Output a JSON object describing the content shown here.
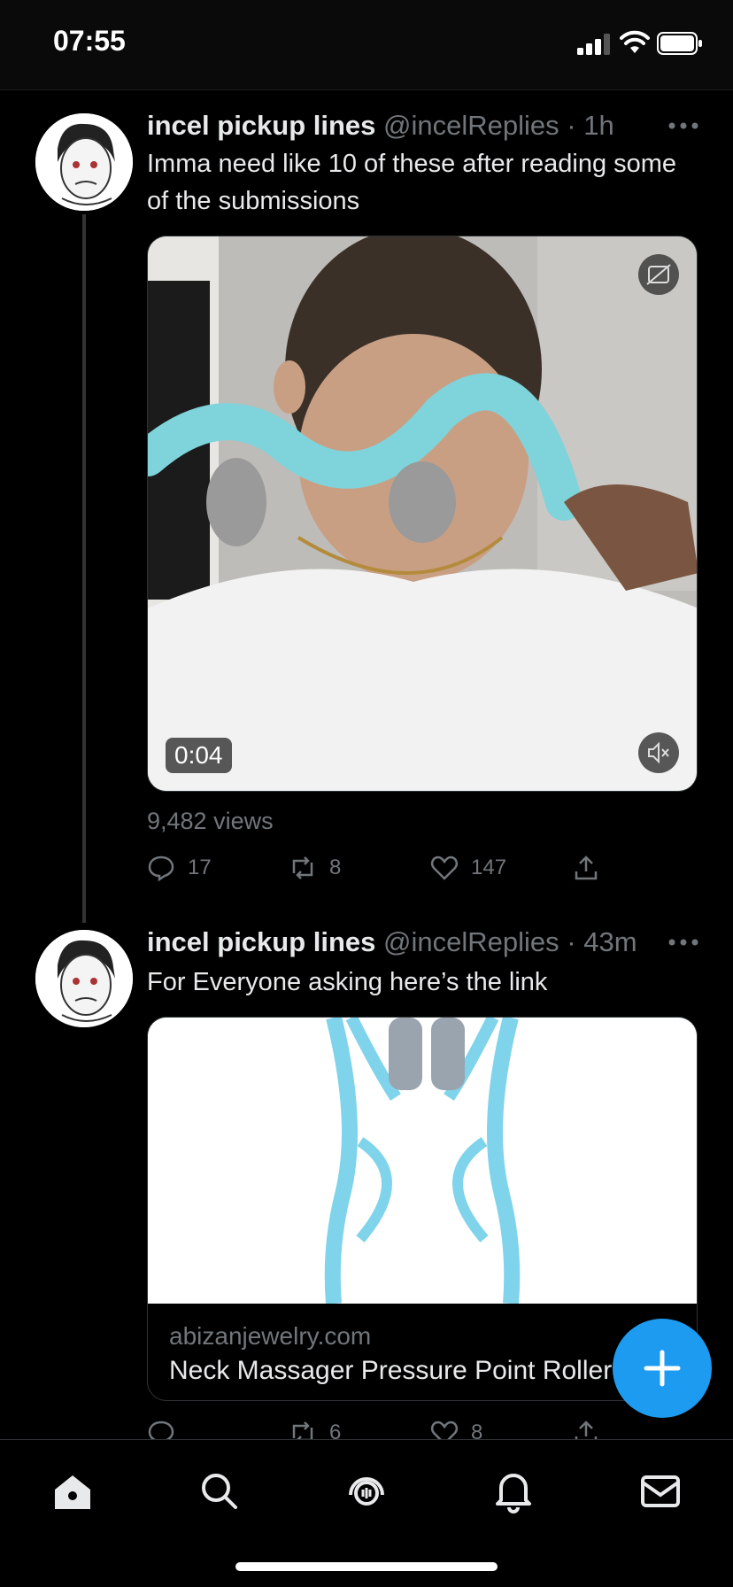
{
  "status_bar": {
    "time": "07:55"
  },
  "tweets": [
    {
      "name": "incel pickup lines",
      "handle": "@incelReplies",
      "separator": "·",
      "age": "1h",
      "text": "Imma need like 10 of these after reading some of the submissions",
      "video": {
        "duration": "0:04"
      },
      "views": "9,482 views",
      "replies": "17",
      "retweets": "8",
      "likes": "147"
    },
    {
      "name": "incel pickup lines",
      "handle": "@incelReplies",
      "separator": "·",
      "age": "43m",
      "text": "For Everyone asking here’s the link",
      "card": {
        "domain": "abizanjewelry.com",
        "title": "Neck Massager Pressure Point Roller"
      },
      "retweets": "6",
      "likes": "8"
    }
  ],
  "tab_bar": {
    "items": [
      "home-icon",
      "search-icon",
      "spaces-icon",
      "notifications-icon",
      "messages-icon"
    ]
  },
  "colors": {
    "accent": "#1d9bf0",
    "muted": "#71767b"
  }
}
